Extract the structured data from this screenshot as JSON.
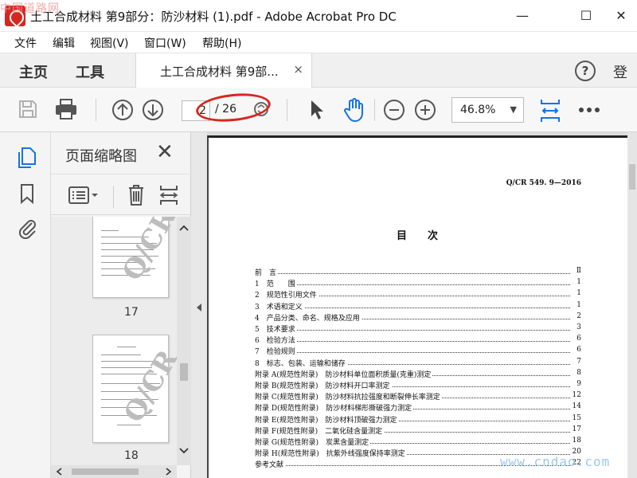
{
  "window": {
    "title": "土工合成材料 第9部分：防沙材料 (1).pdf - Adobe Acrobat Pro DC",
    "minimize": "—",
    "maximize": "☐",
    "close": "✕"
  },
  "watermarks": {
    "top_left": "中国道路网",
    "bottom_right": "www.cndao.com"
  },
  "menu": [
    "文件",
    "编辑",
    "视图(V)",
    "窗口(W)",
    "帮助(H)"
  ],
  "tabs": {
    "home": "主页",
    "tools": "工具",
    "document": "土工合成材料 第9部...",
    "document_close": "×",
    "help": "?",
    "signin": "登"
  },
  "toolbar": {
    "page_current": "2",
    "page_total": "/ 26",
    "zoom": "46.8%",
    "zoom_caret": "▼"
  },
  "thumbnails_panel": {
    "title": "页面缩略图",
    "close": "✕",
    "pages": [
      "17",
      "18"
    ],
    "watermark": "Q/CR"
  },
  "document": {
    "code": "Q/CR 549. 9—2016",
    "heading": "目次",
    "toc": [
      {
        "title": "前　言",
        "page": "Ⅱ"
      },
      {
        "title": "1　范　　围",
        "page": "1"
      },
      {
        "title": "2　规范性引用文件",
        "page": "1"
      },
      {
        "title": "3　术语和定义",
        "page": "1"
      },
      {
        "title": "4　产品分类、命名、规格及应用",
        "page": "2"
      },
      {
        "title": "5　技术要求",
        "page": "3"
      },
      {
        "title": "6　检验方法",
        "page": "6"
      },
      {
        "title": "7　检验规则",
        "page": "6"
      },
      {
        "title": "8　标志、包装、运输和储存",
        "page": "7"
      },
      {
        "title": "附录 A(规范性附录)　防沙材料单位面积质量(克重)测定",
        "page": "8"
      },
      {
        "title": "附录 B(规范性附录)　防沙材料开口率测定",
        "page": "9"
      },
      {
        "title": "附录 C(规范性附录)　防沙材料抗拉强度和断裂伸长率测定",
        "page": "12"
      },
      {
        "title": "附录 D(规范性附录)　防沙材料梯形撕破强力测定",
        "page": "14"
      },
      {
        "title": "附录 E(规范性附录)　防沙材料顶破强力测定",
        "page": "15"
      },
      {
        "title": "附录 F(规范性附录)　二氧化硅含量测定",
        "page": "17"
      },
      {
        "title": "附录 G(规范性附录)　炭黑含量测定",
        "page": "18"
      },
      {
        "title": "附录 H(规范性附录)　抗紫外线强度保持率测定",
        "page": "20"
      },
      {
        "title": "参考文献",
        "page": "22"
      }
    ]
  },
  "colors": {
    "accent_blue": "#1473e6",
    "highlight_red": "#d7261f"
  }
}
